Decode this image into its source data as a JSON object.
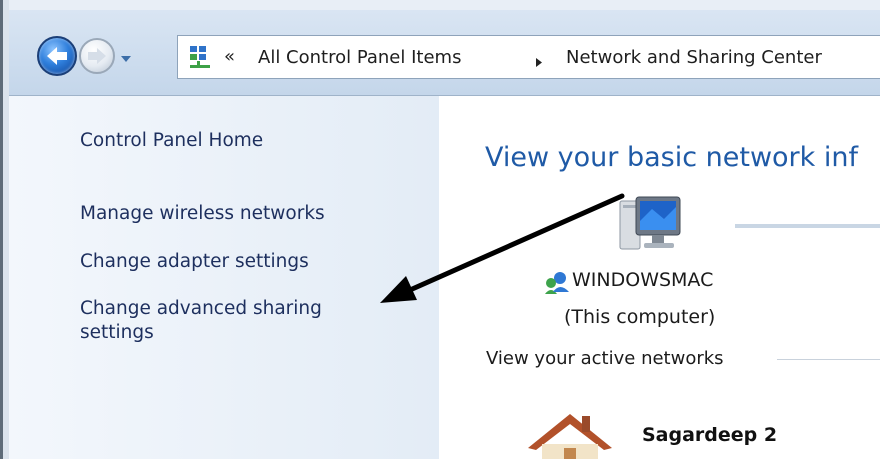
{
  "navigation": {
    "back_icon": "back-arrow-icon",
    "forward_icon": "forward-arrow-icon",
    "history_icon": "chevron-down-icon"
  },
  "address_bar": {
    "icon": "network-icon",
    "overflow_glyph": "«",
    "crumbs": [
      "All Control Panel Items",
      "Network and Sharing Center"
    ]
  },
  "sidebar": {
    "items": [
      {
        "label": "Control Panel Home"
      },
      {
        "label": "Manage wireless networks"
      },
      {
        "label": "Change adapter settings"
      },
      {
        "label": "Change advanced sharing settings"
      }
    ]
  },
  "main": {
    "title": "View your basic network inf",
    "computer": {
      "name": "WINDOWSMAC",
      "subtitle": "(This computer)",
      "icon": "computer-icon"
    },
    "active_networks_label": "View your active networks",
    "network": {
      "name": "Sagardeep  2",
      "icon": "home-network-icon"
    }
  },
  "annotation": {
    "type": "arrow",
    "color": "#000000"
  },
  "colors": {
    "link": "#1d2f5e",
    "title": "#1f5aa6",
    "sidebar_bg": "#e3ecf6",
    "toolbar_bg": "#cfdeef"
  }
}
